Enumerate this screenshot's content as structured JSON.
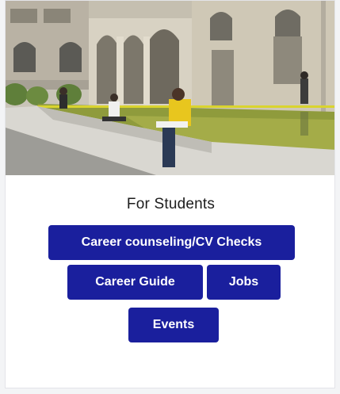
{
  "card": {
    "image": {
      "description_icon": "campus-photo"
    },
    "title": "For Students",
    "buttons": [
      {
        "label": "Career counseling/CV Checks"
      },
      {
        "label": "Career Guide"
      },
      {
        "label": "Jobs"
      },
      {
        "label": "Events"
      }
    ]
  },
  "colors": {
    "button_bg": "#1a1f9d",
    "button_text": "#ffffff",
    "title_text": "#1d1d1d"
  }
}
